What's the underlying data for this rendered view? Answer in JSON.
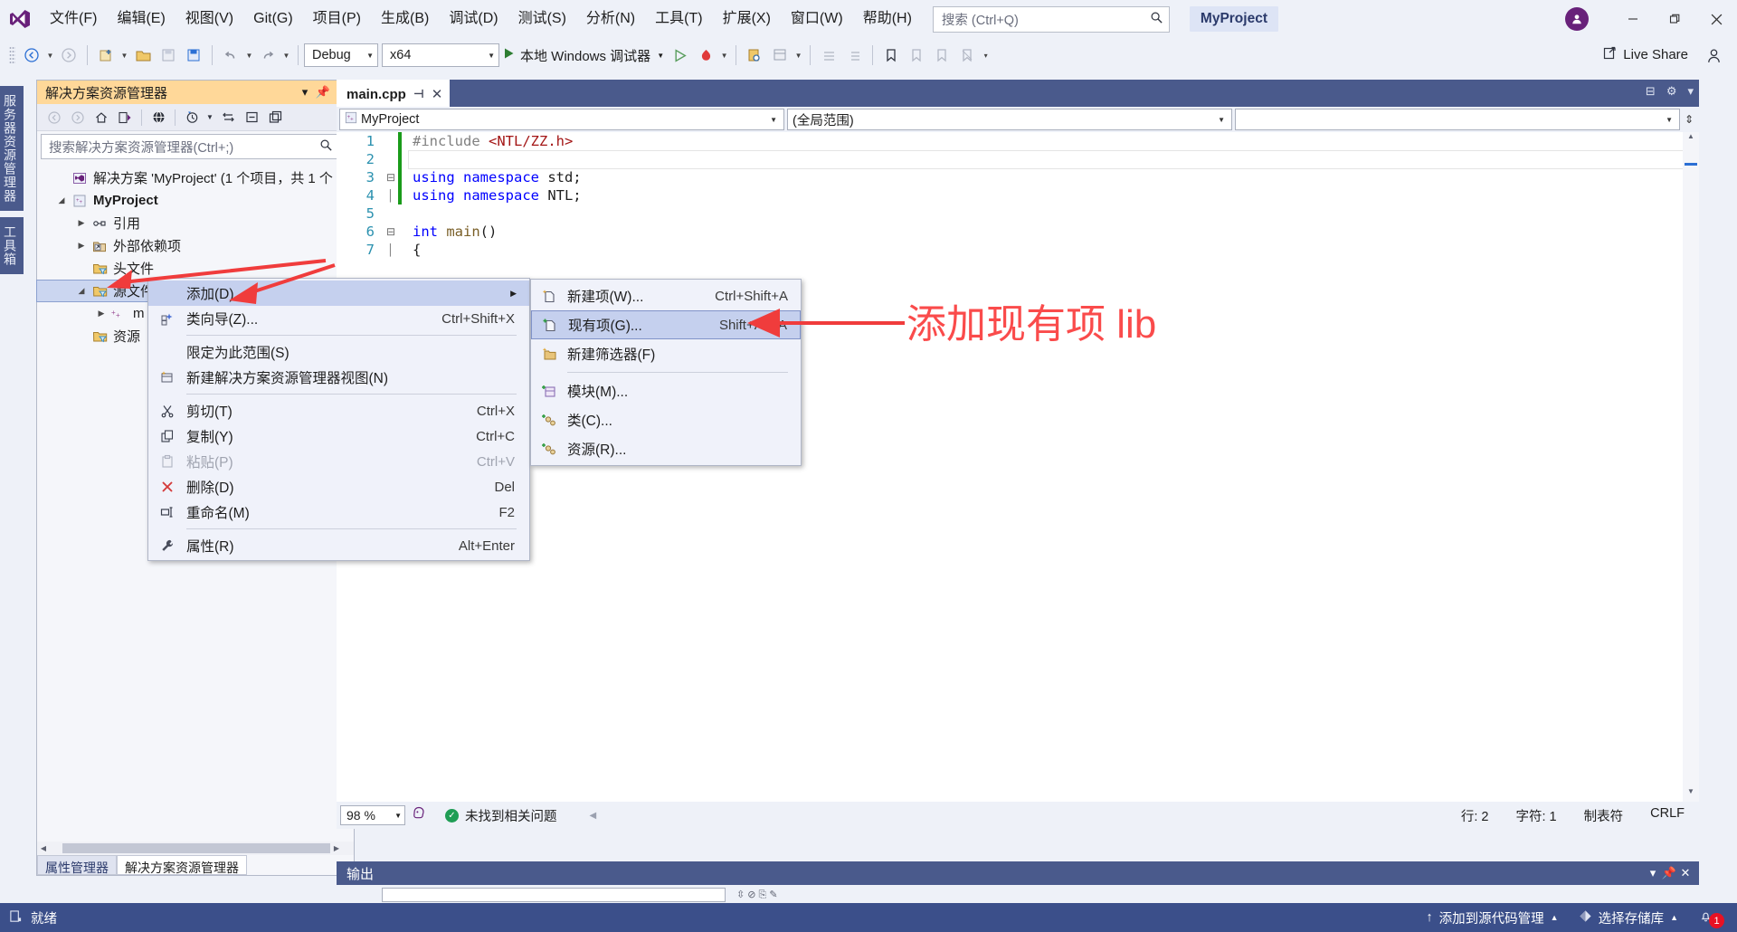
{
  "titlebar": {
    "logo": "vs-logo-icon",
    "menus": [
      "文件(F)",
      "编辑(E)",
      "视图(V)",
      "Git(G)",
      "项目(P)",
      "生成(B)",
      "调试(D)",
      "测试(S)",
      "分析(N)",
      "工具(T)",
      "扩展(X)",
      "窗口(W)",
      "帮助(H)"
    ],
    "search_placeholder": "搜索 (Ctrl+Q)",
    "project_name": "MyProject",
    "window_buttons": {
      "minimize": "–",
      "maximize": "❐",
      "close": "✕"
    }
  },
  "toolbar": {
    "config": "Debug",
    "platform": "x64",
    "run_label": "本地 Windows 调试器",
    "live_share": "Live Share"
  },
  "vtabs": [
    {
      "label": "服务器资源管理器"
    },
    {
      "label": "工具箱"
    }
  ],
  "solution_explorer": {
    "title": "解决方案资源管理器",
    "search_placeholder": "搜索解决方案资源管理器(Ctrl+;)",
    "tree": [
      {
        "label": "解决方案 'MyProject' (1 个项目，共 1 个",
        "indent": 0,
        "arrow": "",
        "icon": "solution-icon",
        "bold": false,
        "selected": false
      },
      {
        "label": "MyProject",
        "indent": 1,
        "arrow": "▲",
        "icon": "cpp-project-icon",
        "bold": true,
        "selected": false
      },
      {
        "label": "引用",
        "indent": 2,
        "arrow": "▶",
        "icon": "references-icon",
        "bold": false,
        "selected": false
      },
      {
        "label": "外部依赖项",
        "indent": 2,
        "arrow": "▶",
        "icon": "ext-deps-icon",
        "bold": false,
        "selected": false
      },
      {
        "label": "头文件",
        "indent": 2,
        "arrow": "",
        "icon": "filter-folder-icon",
        "bold": false,
        "selected": false
      },
      {
        "label": "源文件",
        "indent": 2,
        "arrow": "▲",
        "icon": "filter-folder-icon",
        "bold": false,
        "selected": true
      },
      {
        "label": "m",
        "indent": 3,
        "arrow": "▶",
        "icon": "cpp-file-icon",
        "bold": false,
        "selected": false
      },
      {
        "label": "资源",
        "indent": 2,
        "arrow": "",
        "icon": "filter-folder-icon",
        "bold": false,
        "selected": false
      }
    ],
    "bottom_tabs": [
      {
        "label": "属性管理器",
        "active": false
      },
      {
        "label": "解决方案资源管理器",
        "active": true
      }
    ]
  },
  "editor": {
    "tab_label": "main.cpp",
    "nav_project": "MyProject",
    "nav_scope": "(全局范围)",
    "nav_member": "",
    "lines": [
      {
        "n": "1",
        "fold": "",
        "change": true,
        "tokens": [
          {
            "t": "#include ",
            "c": "k-pp"
          },
          {
            "t": "<NTL/ZZ.h>",
            "c": "k-str"
          }
        ]
      },
      {
        "n": "2",
        "fold": "",
        "change": true,
        "current": true,
        "tokens": []
      },
      {
        "n": "3",
        "fold": "⊟",
        "change": true,
        "tokens": [
          {
            "t": "using namespace ",
            "c": "k-kw"
          },
          {
            "t": "std;",
            "c": "k-id"
          }
        ]
      },
      {
        "n": "4",
        "fold": "│",
        "change": true,
        "tokens": [
          {
            "t": "using namespace ",
            "c": "k-kw"
          },
          {
            "t": "NTL;",
            "c": "k-id"
          }
        ]
      },
      {
        "n": "5",
        "fold": "",
        "change": false,
        "tokens": []
      },
      {
        "n": "6",
        "fold": "⊟",
        "change": false,
        "tokens": [
          {
            "t": "int ",
            "c": "k-kw"
          },
          {
            "t": "main",
            "c": "k-fn"
          },
          {
            "t": "()",
            "c": "k-id"
          }
        ]
      },
      {
        "n": "7",
        "fold": "│",
        "change": false,
        "tokens": [
          {
            "t": "{",
            "c": "k-id"
          }
        ]
      }
    ],
    "status": {
      "zoom": "98 %",
      "issues": "未找到相关问题",
      "line": "行: 2",
      "column": "字符: 1",
      "indent": "制表符",
      "eol": "CRLF"
    }
  },
  "output_panel": {
    "title": "输出"
  },
  "statusbar": {
    "ready": "就绪",
    "source_control": "添加到源代码管理",
    "repository": "选择存储库",
    "notification_count": "1"
  },
  "context_menu": {
    "items": [
      {
        "label": "添加(D)",
        "shortcut": "",
        "icon": "",
        "submenu": true,
        "highlight": true,
        "disabled": false
      },
      {
        "label": "类向导(Z)...",
        "shortcut": "Ctrl+Shift+X",
        "icon": "class-wizard-icon",
        "submenu": false,
        "highlight": false,
        "disabled": false
      },
      {
        "sep": true
      },
      {
        "label": "限定为此范围(S)",
        "shortcut": "",
        "icon": "",
        "submenu": false,
        "highlight": false,
        "disabled": false
      },
      {
        "label": "新建解决方案资源管理器视图(N)",
        "shortcut": "",
        "icon": "new-view-icon",
        "submenu": false,
        "highlight": false,
        "disabled": false
      },
      {
        "sep": true
      },
      {
        "label": "剪切(T)",
        "shortcut": "Ctrl+X",
        "icon": "scissors-icon",
        "submenu": false,
        "highlight": false,
        "disabled": false
      },
      {
        "label": "复制(Y)",
        "shortcut": "Ctrl+C",
        "icon": "copy-icon",
        "submenu": false,
        "highlight": false,
        "disabled": false
      },
      {
        "label": "粘贴(P)",
        "shortcut": "Ctrl+V",
        "icon": "paste-icon",
        "submenu": false,
        "highlight": false,
        "disabled": true
      },
      {
        "label": "删除(D)",
        "shortcut": "Del",
        "icon": "delete-x-icon",
        "submenu": false,
        "highlight": false,
        "disabled": false
      },
      {
        "label": "重命名(M)",
        "shortcut": "F2",
        "icon": "rename-icon",
        "submenu": false,
        "highlight": false,
        "disabled": false
      },
      {
        "sep": true
      },
      {
        "label": "属性(R)",
        "shortcut": "Alt+Enter",
        "icon": "wrench-icon",
        "submenu": false,
        "highlight": false,
        "disabled": false
      }
    ]
  },
  "add_submenu": {
    "items": [
      {
        "label": "新建项(W)...",
        "shortcut": "Ctrl+Shift+A",
        "icon": "new-item-icon",
        "highlight": false
      },
      {
        "label": "现有项(G)...",
        "shortcut": "Shift+Alt+A",
        "icon": "existing-item-icon",
        "highlight": true
      },
      {
        "label": "新建筛选器(F)",
        "shortcut": "",
        "icon": "new-filter-icon",
        "highlight": false
      },
      {
        "sep": true
      },
      {
        "label": "模块(M)...",
        "shortcut": "",
        "icon": "module-icon",
        "highlight": false
      },
      {
        "label": "类(C)...",
        "shortcut": "",
        "icon": "class-icon",
        "highlight": false
      },
      {
        "label": "资源(R)...",
        "shortcut": "",
        "icon": "resource-icon",
        "highlight": false
      }
    ]
  },
  "annotation": {
    "text": "添加现有项 lib",
    "color": "#fa4b4b"
  },
  "colors": {
    "accent_blue": "#3b4f8a",
    "title_orange": "#ffd899",
    "annotation_red": "#fa4b4b",
    "selection_blue": "#c5d0ee"
  }
}
